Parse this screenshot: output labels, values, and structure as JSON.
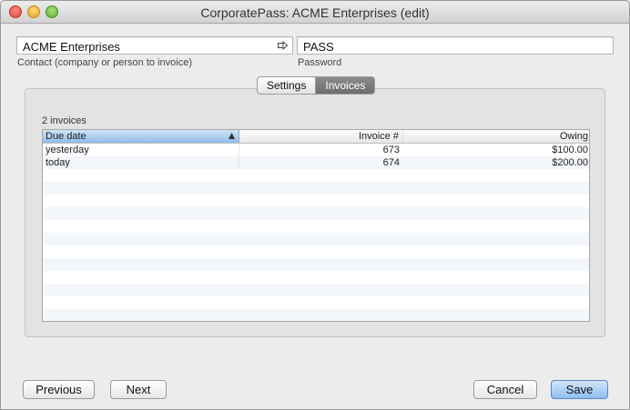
{
  "window": {
    "title": "CorporatePass: ACME Enterprises (edit)"
  },
  "form": {
    "contact_value": "ACME Enterprises",
    "contact_caption": "Contact (company or person to invoice)",
    "password_value": "PASS",
    "password_caption": "Password"
  },
  "tabs": [
    {
      "label": "Settings",
      "selected": false
    },
    {
      "label": "Invoices",
      "selected": true
    }
  ],
  "invoices": {
    "count_label": "2 invoices",
    "columns": [
      "Due date",
      "Invoice #",
      "Owing"
    ],
    "sort_column": "Due date",
    "rows": [
      {
        "due": "yesterday",
        "invoice": "673",
        "owing": "$100.00"
      },
      {
        "due": "today",
        "invoice": "674",
        "owing": "$200.00"
      }
    ]
  },
  "buttons": {
    "previous": "Previous",
    "next": "Next",
    "cancel": "Cancel",
    "save": "Save"
  },
  "icons": {
    "contact_link": "arrow-right-icon",
    "sort": "sort-ascending-icon"
  },
  "colors": {
    "selected_header": "#8ebde9",
    "default_button": "#8ebdf0"
  }
}
